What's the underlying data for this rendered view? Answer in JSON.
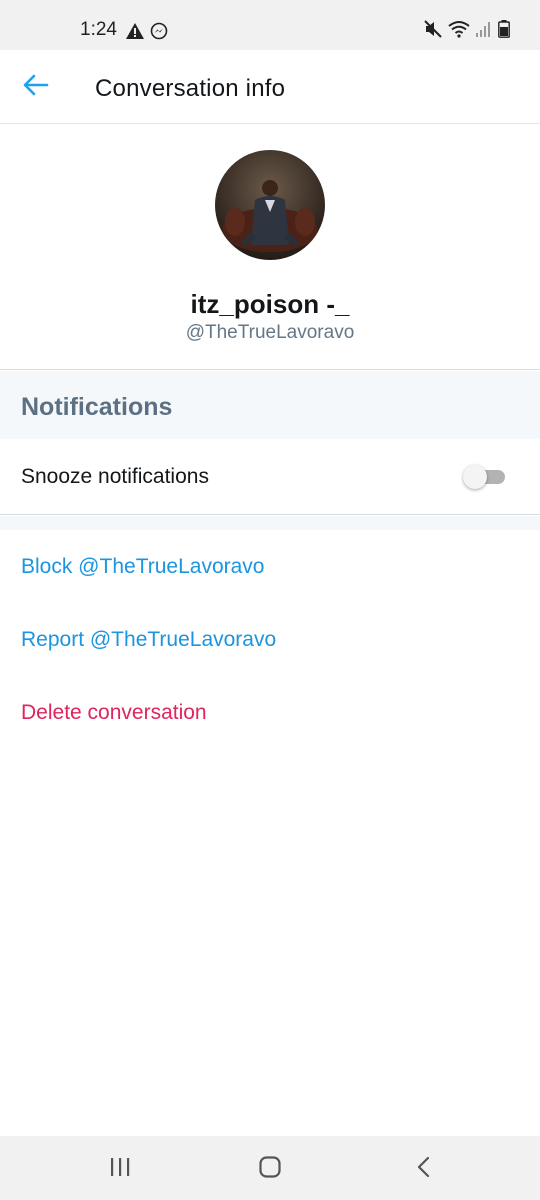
{
  "status_bar": {
    "time": "1:24",
    "left_icons": [
      "warning-icon",
      "messenger-icon"
    ],
    "right_icons": [
      "mute-icon",
      "wifi-icon",
      "signal-icon",
      "battery-icon"
    ]
  },
  "header": {
    "title": "Conversation info",
    "back_icon": "arrow-left-icon"
  },
  "profile": {
    "display_name": "itz_poison -_",
    "handle": "@TheTrueLavoravo"
  },
  "notifications": {
    "section_title": "Notifications",
    "snooze_label": "Snooze notifications",
    "snooze_enabled": false
  },
  "actions": {
    "block_label": "Block @TheTrueLavoravo",
    "report_label": "Report @TheTrueLavoravo",
    "delete_label": "Delete conversation"
  },
  "colors": {
    "link": "#1b95e0",
    "danger": "#e0245e",
    "section_title": "#5b7083",
    "accent_back": "#1da1f2"
  },
  "nav_bar": {
    "icons": [
      "recent-apps-icon",
      "home-icon",
      "back-nav-icon"
    ]
  }
}
